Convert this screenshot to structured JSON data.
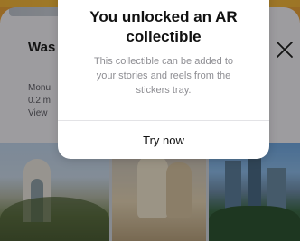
{
  "background_sheet": {
    "title": "Was",
    "line1": "Monu",
    "line2": "0.2 m",
    "line3": "View"
  },
  "modal": {
    "title_line1": "You unlocked an AR",
    "title_line2": "collectible",
    "body_line1": "This collectible can be added to",
    "body_line2": "your stories and reels from the",
    "body_line3": "stickers tray.",
    "action_label": "Try now"
  },
  "icons": [
    "close-icon"
  ],
  "colors": {
    "app_accent": "#F2B43B",
    "modal_bg": "#FFFFFF",
    "title_text": "#111111",
    "body_text": "#8E8E93"
  }
}
